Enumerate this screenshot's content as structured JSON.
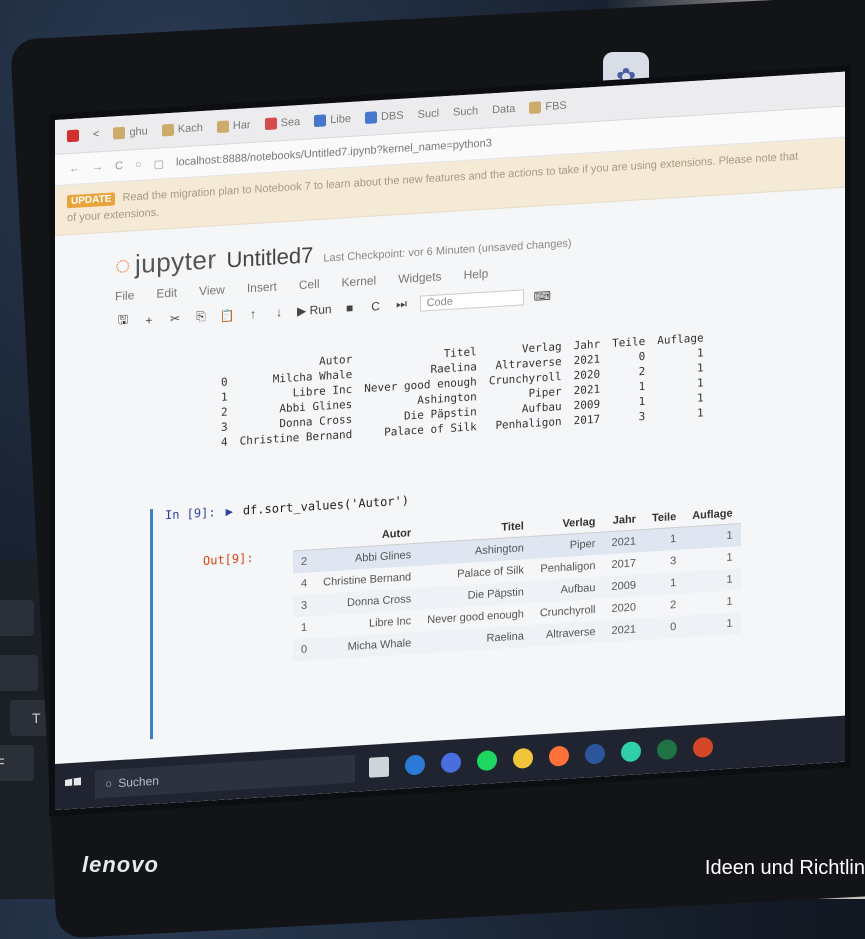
{
  "webcam_icon": "webcam-sticker",
  "browser": {
    "tabs": [
      "ghu",
      "Kach",
      "Har",
      "Sea",
      "Libe",
      "DBS",
      "Sucl",
      "Such",
      "Data",
      "FBS"
    ],
    "address": "localhost:8888/notebooks/Untitled7.ipynb?kernel_name=python3",
    "banner_badge": "UPDATE",
    "banner_text": "Read the migration plan to Notebook 7 to learn about the new features and the actions to take if you are using extensions. Please note that",
    "banner_text2": "of your extensions."
  },
  "jupyter": {
    "logo": "jupyter",
    "notebook_name": "Untitled7",
    "checkpoint": "Last Checkpoint: vor 6 Minuten  (unsaved changes)",
    "menu": [
      "File",
      "Edit",
      "View",
      "Insert",
      "Cell",
      "Kernel",
      "Widgets",
      "Help"
    ],
    "toolbar": [
      "▶ Run",
      "■",
      "C",
      "⏭"
    ],
    "cell_type": "Code"
  },
  "output1": {
    "headers": [
      "",
      "Autor",
      "Titel",
      "Verlag",
      "Jahr",
      "Teile",
      "Auflage"
    ],
    "rows": [
      [
        "0",
        "Milcha Whale",
        "Raelina",
        "Altraverse",
        "2021",
        "0",
        "1"
      ],
      [
        "1",
        "Libre Inc",
        "Never good enough",
        "Crunchyroll",
        "2020",
        "2",
        "1"
      ],
      [
        "2",
        "Abbi Glines",
        "Ashington",
        "Piper",
        "2021",
        "1",
        "1"
      ],
      [
        "3",
        "Donna Cross",
        "Die Päpstin",
        "Aufbau",
        "2009",
        "1",
        "1"
      ],
      [
        "4",
        "Christine Bernand",
        "Palace of Silk",
        "Penhaligon",
        "2017",
        "3",
        "1"
      ]
    ]
  },
  "cell2": {
    "in_prompt": "In [9]:",
    "code": "df.sort_values('Autor')",
    "out_prompt": "Out[9]:",
    "headers": [
      "",
      "Autor",
      "Titel",
      "Verlag",
      "Jahr",
      "Teile",
      "Auflage"
    ],
    "rows": [
      [
        "2",
        "Abbi Glines",
        "Ashington",
        "Piper",
        "2021",
        "1",
        "1"
      ],
      [
        "4",
        "Christine Bernand",
        "Palace of Silk",
        "Penhaligon",
        "2017",
        "3",
        "1"
      ],
      [
        "3",
        "Donna Cross",
        "Die Päpstin",
        "Aufbau",
        "2009",
        "1",
        "1"
      ],
      [
        "1",
        "Libre Inc",
        "Never good enough",
        "Crunchyroll",
        "2020",
        "2",
        "1"
      ],
      [
        "0",
        "Micha Whale",
        "Raelina",
        "Altraverse",
        "2021",
        "0",
        "1"
      ]
    ]
  },
  "taskbar": {
    "search_placeholder": "Suchen",
    "icons": [
      "task-view-icon",
      "edge-icon",
      "chrome-icon",
      "spotify-icon",
      "explorer-icon",
      "firefox-icon",
      "word-icon",
      "app-icon",
      "excel-icon",
      "powerpoint-icon"
    ],
    "colors": [
      "#cfd3da",
      "#2a7ad6",
      "#4a6ee0",
      "#1ed760",
      "#f0c53a",
      "#ff7139",
      "#2b579a",
      "#2fd0a8",
      "#1f7244",
      "#d24726"
    ]
  },
  "brand": "lenovo",
  "caption": "Ideen und Richtlin"
}
